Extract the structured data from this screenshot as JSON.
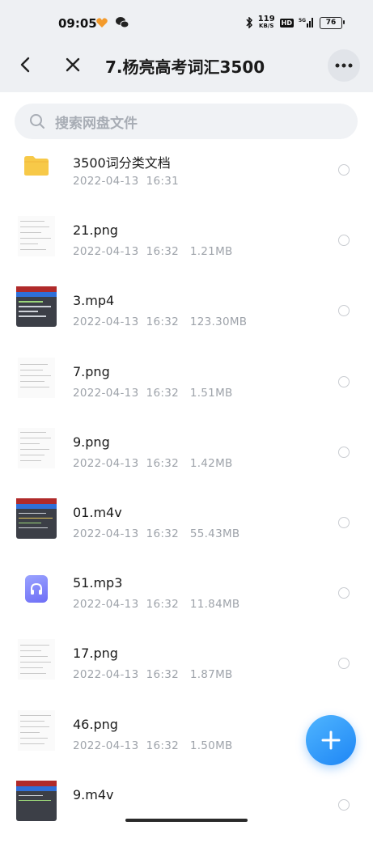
{
  "status_bar": {
    "time": "09:05",
    "net_speed_value": "119",
    "net_speed_unit": "KB/S",
    "hd_label": "HD",
    "network_label": "5G",
    "battery": "76"
  },
  "header": {
    "title": "7.杨亮高考词汇3500"
  },
  "search": {
    "placeholder": "搜索网盘文件"
  },
  "files": [
    {
      "name": "3500词分类文档",
      "meta": "2022-04-13  16:31",
      "kind": "folder"
    },
    {
      "name": "21.png",
      "meta": "2022-04-13  16:32   1.21MB",
      "kind": "image"
    },
    {
      "name": "3.mp4",
      "meta": "2022-04-13  16:32   123.30MB",
      "kind": "video"
    },
    {
      "name": "7.png",
      "meta": "2022-04-13  16:32   1.51MB",
      "kind": "image"
    },
    {
      "name": "9.png",
      "meta": "2022-04-13  16:32   1.42MB",
      "kind": "image"
    },
    {
      "name": "01.m4v",
      "meta": "2022-04-13  16:32   55.43MB",
      "kind": "video"
    },
    {
      "name": "51.mp3",
      "meta": "2022-04-13  16:32   11.84MB",
      "kind": "audio"
    },
    {
      "name": "17.png",
      "meta": "2022-04-13  16:32   1.87MB",
      "kind": "image"
    },
    {
      "name": "46.png",
      "meta": "2022-04-13  16:32   1.50MB",
      "kind": "image"
    },
    {
      "name": "9.m4v",
      "meta": "",
      "kind": "video"
    }
  ],
  "icons": {
    "back": "back-arrow-icon",
    "close": "close-icon",
    "more": "more-dots-icon",
    "search": "search-icon",
    "add": "plus-icon"
  },
  "colors": {
    "accent": "#1e86f5",
    "header_bg": "#eef0f3",
    "folder": "#f7c948"
  }
}
